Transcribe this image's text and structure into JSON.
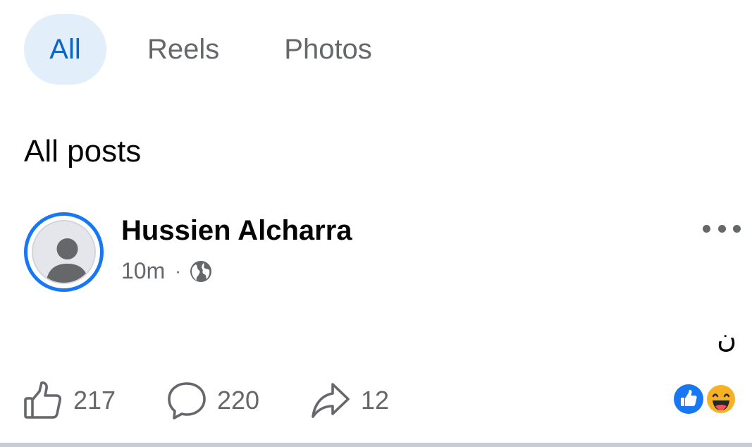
{
  "tabs": [
    {
      "label": "All",
      "active": true
    },
    {
      "label": "Reels",
      "active": false
    },
    {
      "label": "Photos",
      "active": false
    }
  ],
  "section_title": "All posts",
  "post": {
    "author": "Hussien Alcharra",
    "time": "10m",
    "separator": "·",
    "privacy_icon": "globe-icon",
    "text": "ن",
    "actions": {
      "like_count": "217",
      "comment_count": "220",
      "share_count": "12"
    },
    "reactions": [
      "like-reaction-icon",
      "haha-reaction-icon"
    ]
  },
  "colors": {
    "accent": "#1877f2",
    "active_tab_bg": "#e3eefb",
    "active_tab_text": "#0a66c2",
    "muted_text": "#65676b"
  }
}
